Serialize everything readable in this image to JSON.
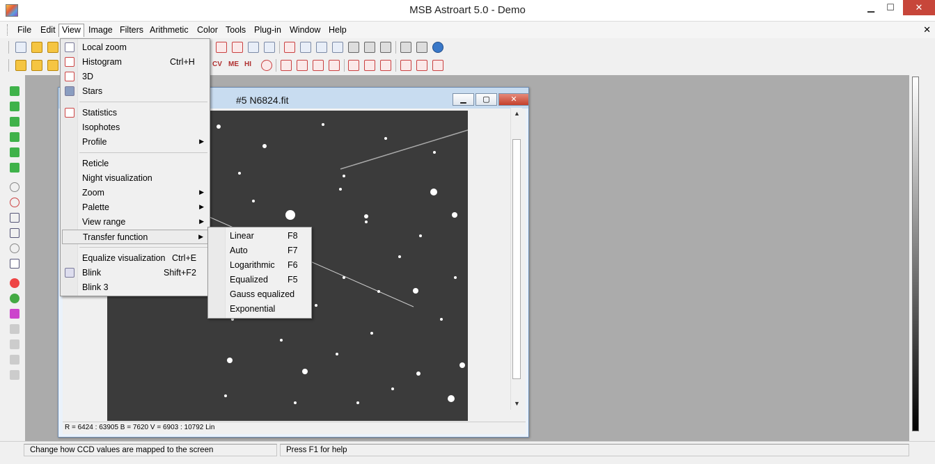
{
  "window": {
    "title": "MSB Astroart 5.0 - Demo",
    "minimize": "▁",
    "maximize": "☐",
    "close": "✕"
  },
  "menu": [
    "File",
    "Edit",
    "View",
    "Image",
    "Filters",
    "Arithmetic",
    "Color",
    "Tools",
    "Plug-in",
    "Window",
    "Help"
  ],
  "mdi_close": "✕",
  "toolbar2_text": [
    "CV",
    "ME",
    "HI"
  ],
  "child_window": {
    "title": "#5 N6824.fit",
    "status": "R = 6424 : 63905    B = 7620    V = 6903 : 10792 Lin"
  },
  "view_menu": {
    "items": [
      {
        "label": "Local zoom",
        "shortcut": "",
        "icon": "magnifier-icon",
        "submenu": false
      },
      {
        "label": "Histogram",
        "shortcut": "Ctrl+H",
        "icon": "histogram-icon",
        "submenu": false
      },
      {
        "label": "3D",
        "shortcut": "",
        "icon": "3d-icon",
        "submenu": false
      },
      {
        "label": "Stars",
        "shortcut": "",
        "icon": "stars-icon",
        "submenu": false
      },
      {
        "label": "Statistics",
        "shortcut": "",
        "icon": "sigma-icon",
        "submenu": false
      },
      {
        "label": "Isophotes",
        "shortcut": "",
        "icon": "",
        "submenu": false
      },
      {
        "label": "Profile",
        "shortcut": "",
        "icon": "",
        "submenu": true
      },
      {
        "label": "Reticle",
        "shortcut": "",
        "icon": "",
        "submenu": false
      },
      {
        "label": "Night visualization",
        "shortcut": "",
        "icon": "",
        "submenu": false
      },
      {
        "label": "Zoom",
        "shortcut": "",
        "icon": "",
        "submenu": true
      },
      {
        "label": "Palette",
        "shortcut": "",
        "icon": "",
        "submenu": true
      },
      {
        "label": "View range",
        "shortcut": "",
        "icon": "",
        "submenu": true
      },
      {
        "label": "Transfer function",
        "shortcut": "",
        "icon": "",
        "submenu": true,
        "highlighted": true
      },
      {
        "label": "Equalize visualization",
        "shortcut": "Ctrl+E",
        "icon": "",
        "submenu": false
      },
      {
        "label": "Blink",
        "shortcut": "Shift+F2",
        "icon": "eye-icon",
        "submenu": false
      },
      {
        "label": "Blink 3",
        "shortcut": "",
        "icon": "",
        "submenu": false
      }
    ]
  },
  "transfer_menu": {
    "items": [
      {
        "label": "Linear",
        "shortcut": "F8"
      },
      {
        "label": "Auto",
        "shortcut": "F7"
      },
      {
        "label": "Logarithmic",
        "shortcut": "F6"
      },
      {
        "label": "Equalized",
        "shortcut": "F5"
      },
      {
        "label": "Gauss equalized",
        "shortcut": ""
      },
      {
        "label": "Exponential",
        "shortcut": ""
      }
    ]
  },
  "statusbar": {
    "hint": "Change how CCD values are mapped to the screen",
    "help": "Press F1 for help"
  }
}
